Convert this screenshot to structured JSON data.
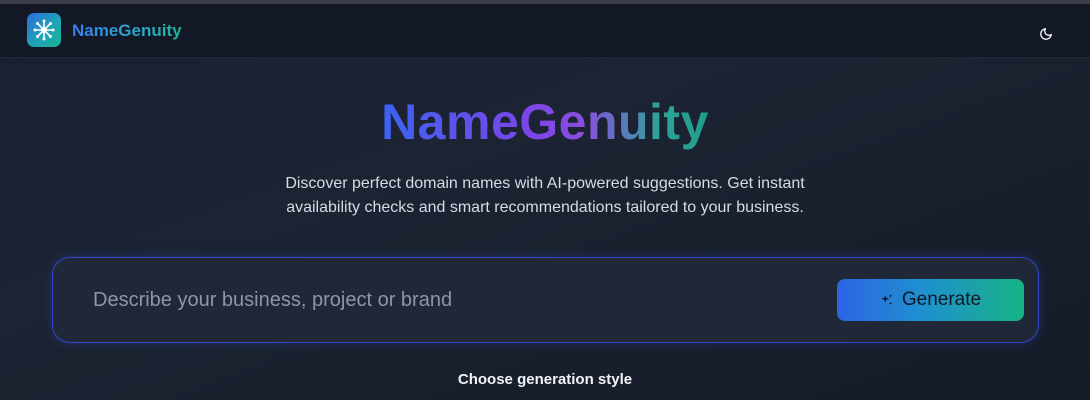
{
  "navbar": {
    "brand": "NameGenuity",
    "logo_icon": "network-hub-icon",
    "theme_toggle_icon": "moon-icon"
  },
  "hero": {
    "title": "NameGenuity",
    "subtitle": "Discover perfect domain names with AI-powered suggestions. Get instant availability checks and smart recommendations tailored to your business."
  },
  "search": {
    "placeholder": "Describe your business, project or brand",
    "value": "",
    "button_label": "Generate",
    "button_icon": "sparkles-icon"
  },
  "styles_section": {
    "label": "Choose generation style"
  },
  "colors": {
    "accent_blue": "#2c64e6",
    "accent_teal": "#17b386",
    "accent_purple": "#7b45e8",
    "background": "#1a2030"
  }
}
